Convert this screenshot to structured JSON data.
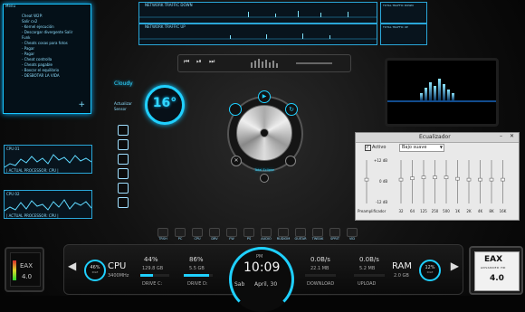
{
  "left_menu": {
    "title": "Menu",
    "items": [
      "Cheat W2P:",
      "Salir cx2",
      "- Kernel ejecución",
      "- Descargar divergente Salir",
      "Funk",
      "- Cheats cosas para fotos",
      "- Pagar",
      "- Pagar",
      "- Cheat controlla",
      "- Cheats pagable",
      "- Boxcar el equilibrio",
      "- DESBOTAR LA VIDA"
    ]
  },
  "left_graphs": {
    "graph1_label": "CPU 01",
    "graph1_footer": "| ACTUAL PROCESSOR: CPU |",
    "graph2_label": "CPU 02",
    "graph2_footer": "| ACTUAL PROCESSOR: CPU |"
  },
  "weather": {
    "condition": "Cloudy",
    "temperature": "16°",
    "note1": "Actualizar",
    "note2": "Sensor"
  },
  "network": {
    "down_title": "NETWORK TRAFFIC DOWN",
    "down_total": "TOTAL TRAFFIC DOWN",
    "up_title": "NETWORK TRAFFIC UP",
    "up_total": "TOTAL TRAFFIC UP"
  },
  "player_top": {
    "prev": "⏮",
    "play": "⏯",
    "next": "⏭"
  },
  "player_ring": {
    "track_title": "Total Eclipse",
    "track_subtitle": "Playing"
  },
  "equalizer": {
    "title": "Ecualizador",
    "active_label": "Activo",
    "preset": "Bajo suave",
    "db_top": "+12 dB",
    "db_mid": "0 dB",
    "db_bottom": "-12 dB",
    "preamp": "Preamplificador",
    "bands": [
      "32",
      "64",
      "125",
      "250",
      "500",
      "1K",
      "2K",
      "4K",
      "8K",
      "16K"
    ],
    "band_levels": [
      0.55,
      0.58,
      0.6,
      0.6,
      0.6,
      0.57,
      0.55,
      0.55,
      0.55,
      0.55
    ],
    "preamp_level": 0.55
  },
  "dock": {
    "items": [
      "TRSH",
      "PC",
      "CPU",
      "DRV",
      "FW",
      "PS",
      "AUDIO",
      "RUDIOM",
      "GUITAR",
      "TWEAK",
      "SPRIT",
      "VID"
    ]
  },
  "hud": {
    "cpu_percent": "46%",
    "cpu_percent_sub": "IDLE",
    "cpu_label": "CPU",
    "cpu_freq": "3400MHz",
    "drive_c_percent": "44%",
    "drive_c_size": "129.8 GB",
    "drive_c_label": "DRIVE C:",
    "drive_d_percent": "86%",
    "drive_d_size": "5.5 GB",
    "drive_d_label": "DRIVE D:",
    "time_ampm": "PM",
    "time": "10:09",
    "day": "Sab",
    "date": "April, 30",
    "down_rate": "0.0B/s",
    "down_total": "22.1 MB",
    "download_label": "DOWNLOAD",
    "up_rate": "0.0B/s",
    "up_total": "5.2 MB",
    "upload_label": "UPLOAD",
    "ram_label": "RAM",
    "ram_size": "2.0 GB",
    "ram_percent": "12%",
    "ram_percent_sub": "IDLE"
  },
  "eax_left": {
    "text": "EAX",
    "version": "4.0"
  },
  "eax_right": {
    "brand": "EAX",
    "subtitle": "ADVANCED HD",
    "version": "4.0"
  }
}
